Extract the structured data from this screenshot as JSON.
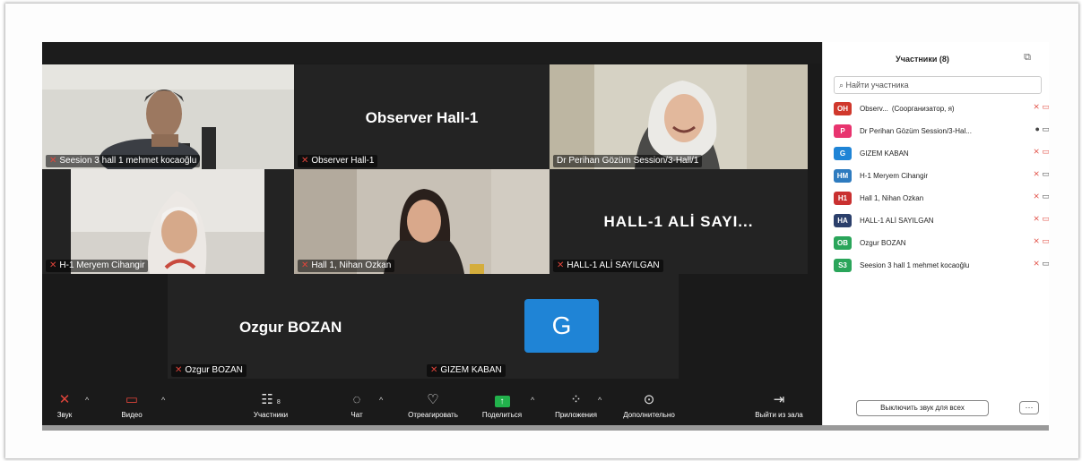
{
  "tiles": {
    "mehmet": {
      "caption": "Seesion 3 hall 1 mehmet kocaoğlu"
    },
    "observer": {
      "big_name": "Observer Hall-1",
      "caption": "Observer Hall-1"
    },
    "perihan": {
      "caption": "Dr Perihan Gözüm Session/3-Hall/1"
    },
    "meryem": {
      "caption": "H-1 Meryem Cihangir"
    },
    "nihan": {
      "caption": "Hall 1, Nihan Ozkan"
    },
    "ali": {
      "big_name": "HALL-1 ALİ SAYI...",
      "caption": "HALL-1 ALİ SAYILGAN"
    },
    "ozgur": {
      "big_name": "Ozgur BOZAN",
      "caption": "Ozgur BOZAN"
    },
    "gizem": {
      "avatar_letter": "G",
      "caption": "GIZEM KABAN"
    }
  },
  "toolbar": {
    "audio": "Звук",
    "video": "Видео",
    "participants": "Участники",
    "participants_count": "8",
    "chat": "Чат",
    "react": "Отреагировать",
    "share": "Поделиться",
    "apps": "Приложения",
    "more": "Дополнительно",
    "leave": "Выйти из зала"
  },
  "panel": {
    "title": "Участники (8)",
    "search_placeholder": "Найти участника",
    "mute_all": "Выключить звук для всех",
    "more_label": "···",
    "participants": [
      {
        "initials": "OH",
        "color": "#d0382c",
        "name": "Observ...",
        "role": "(Соорганизатор, я)",
        "mic": "muted",
        "cam": "off"
      },
      {
        "initials": "P",
        "color": "#e8346f",
        "name": "Dr Perihan Gözüm Session/3-Hal...",
        "role": "",
        "mic": "on",
        "cam": "on"
      },
      {
        "initials": "G",
        "color": "#1f84d6",
        "name": "GIZEM KABAN",
        "role": "",
        "mic": "muted",
        "cam": "off"
      },
      {
        "initials": "HM",
        "color": "#2e7bbf",
        "name": "H-1 Meryem Cihangir",
        "role": "",
        "mic": "muted",
        "cam": "on"
      },
      {
        "initials": "H1",
        "color": "#c93030",
        "name": "Hall 1, Nihan Ozkan",
        "role": "",
        "mic": "muted",
        "cam": "on"
      },
      {
        "initials": "HA",
        "color": "#2b3f6b",
        "name": "HALL-1 ALİ SAYILGAN",
        "role": "",
        "mic": "muted",
        "cam": "off"
      },
      {
        "initials": "OB",
        "color": "#2aa55a",
        "name": "Ozgur BOZAN",
        "role": "",
        "mic": "muted",
        "cam": "off"
      },
      {
        "initials": "S3",
        "color": "#2aa55a",
        "name": "Seesion 3 hall 1 mehmet kocaoğlu",
        "role": "",
        "mic": "muted",
        "cam": "on"
      }
    ]
  },
  "colors": {
    "meeting_bg": "#1a1a1a",
    "tile_bg": "#232323",
    "active_speaker": "#3fc25a",
    "muted": "#e0443a",
    "share_green": "#22b24c"
  }
}
